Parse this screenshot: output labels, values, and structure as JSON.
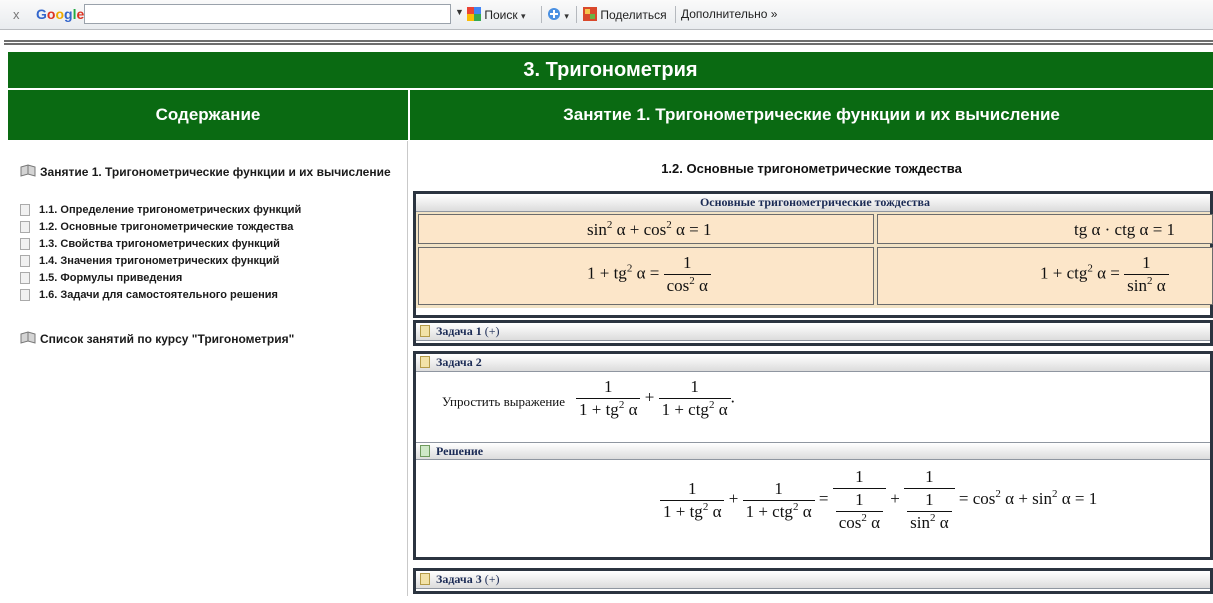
{
  "toolbar": {
    "close": "x",
    "logo": "Google",
    "search_value": "",
    "search_btn": "Поиск",
    "share_btn": "Поделиться",
    "more_btn": "Дополнительно »"
  },
  "page": {
    "title": "3. Тригонометрия"
  },
  "sidebar": {
    "header": "Содержание",
    "lesson": "Занятие 1. Тригонометрические функции и их вычисление",
    "items": [
      "1.1. Определение тригонометрических функций",
      "1.2. Основные тригонометрические тождества",
      "1.3. Свойства тригонометрических функций",
      "1.4. Значения тригонометрических функций",
      "1.5. Формулы приведения",
      "1.6. Задачи для самостоятельного решения"
    ],
    "course_list": "Список занятий по курсу \"Тригонометрия\""
  },
  "main": {
    "header": "Занятие 1. Тригонометрические функции и их вычисление",
    "section_title": "1.2. Основные тригонометрические тождества",
    "identities_title": "Основные тригонометрические тождества",
    "identities": {
      "i1": "sin² α + cos² α = 1",
      "i2": "tg α · ctg α = 1",
      "i3": "1 + tg² α = 1 / cos² α",
      "i4": "1 + ctg² α = 1 / sin² α"
    },
    "task1": "Задача 1",
    "task2": "Задача 2",
    "task2_text": "Упростить выражение",
    "solution": "Решение",
    "task3": "Задача 3",
    "expand": "(+)"
  },
  "colors": {
    "header_green": "#0a6a12",
    "box_border": "#2b3440",
    "cell_bg": "#fce6c9"
  }
}
